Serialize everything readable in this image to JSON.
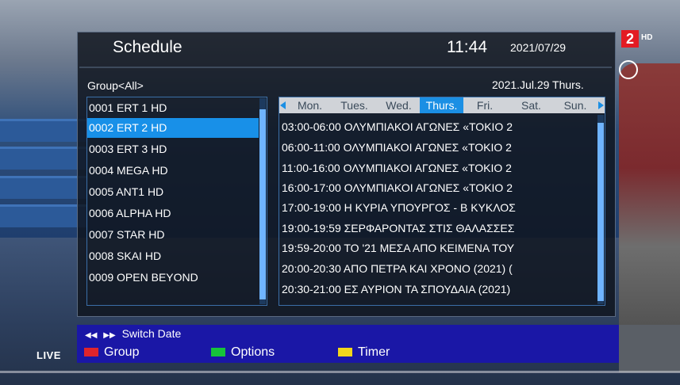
{
  "channel_logo": {
    "number": "2",
    "hd": "HD"
  },
  "header": {
    "title": "Schedule",
    "time": "11:44",
    "date": "2021/07/29"
  },
  "group_label": "Group<All>",
  "selected_date": "2021.Jul.29 Thurs.",
  "channels": [
    {
      "label": "0001 ERT 1 HD"
    },
    {
      "label": "0002 ERT 2 HD",
      "selected": true
    },
    {
      "label": "0003 ERT 3 HD"
    },
    {
      "label": "0004 MEGA HD"
    },
    {
      "label": "0005 ANT1 HD"
    },
    {
      "label": "0006 ALPHA HD"
    },
    {
      "label": "0007 STAR HD"
    },
    {
      "label": "0008 SKAI HD"
    },
    {
      "label": "0009 OPEN BEYOND"
    }
  ],
  "days": [
    "Mon.",
    "Tues.",
    "Wed.",
    "Thurs.",
    "Fri.",
    "Sat.",
    "Sun."
  ],
  "selected_day": "Thurs.",
  "events": [
    {
      "label": "03:00-06:00  ΟΛΥΜΠΙΑΚΟΙ ΑΓΩΝΕΣ «ΤΟΚΙΟ 2"
    },
    {
      "label": "06:00-11:00  ΟΛΥΜΠΙΑΚΟΙ ΑΓΩΝΕΣ «ΤΟΚΙΟ 2"
    },
    {
      "label": "11:00-16:00  ΟΛΥΜΠΙΑΚΟΙ ΑΓΩΝΕΣ «ΤΟΚΙΟ 2"
    },
    {
      "label": "16:00-17:00  ΟΛΥΜΠΙΑΚΟΙ ΑΓΩΝΕΣ «ΤΟΚΙΟ 2"
    },
    {
      "label": "17:00-19:00  Η ΚΥΡΙΑ ΥΠΟΥΡΓΟΣ - Β ΚΥΚΛΟΣ"
    },
    {
      "label": "19:00-19:59  ΣΕΡΦΑΡΟΝΤΑΣ ΣΤΙΣ ΘΑΛΑΣΣΕΣ"
    },
    {
      "label": "19:59-20:00  ΤΟ '21 ΜΕΣΑ ΑΠΟ ΚΕΙΜΕΝΑ ΤΟΥ"
    },
    {
      "label": "20:00-20:30  ΑΠΟ ΠΕΤΡΑ ΚΑΙ ΧΡΟΝΟ (2021) ("
    },
    {
      "label": "20:30-21:00  ΕΣ ΑΥΡΙΟΝ ΤΑ ΣΠΟΥΔΑΙΑ (2021)"
    }
  ],
  "footer": {
    "switch_date": "Switch Date",
    "keys": [
      {
        "label": "Group",
        "color": "#e0242c"
      },
      {
        "label": "Options",
        "color": "#16c43a"
      },
      {
        "label": "Timer",
        "color": "#f2d61b"
      }
    ]
  },
  "live_badge": "LIVE"
}
